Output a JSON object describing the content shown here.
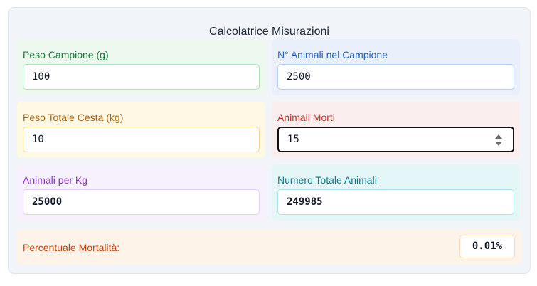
{
  "title": "Calcolatrice Misurazioni",
  "fields": {
    "peso_campione": {
      "label": "Peso Campione (g)",
      "value": "100"
    },
    "animali_campione": {
      "label": "N° Animali nel Campione",
      "value": "2500"
    },
    "peso_cesta": {
      "label": "Peso Totale Cesta (kg)",
      "value": "10"
    },
    "animali_morti": {
      "label": "Animali Morti",
      "value": "15"
    },
    "animali_per_kg": {
      "label": "Animali per Kg",
      "value": "25000"
    },
    "totale_animali": {
      "label": "Numero Totale Animali",
      "value": "249985"
    }
  },
  "result": {
    "label": "Percentuale Mortalità:",
    "value": "0.01%"
  },
  "colors": {
    "green": "#15803d",
    "blue": "#2463c9",
    "orange": "#b45f06",
    "red": "#c22c2c",
    "purple": "#8b32c8",
    "teal": "#0f7c8c"
  }
}
